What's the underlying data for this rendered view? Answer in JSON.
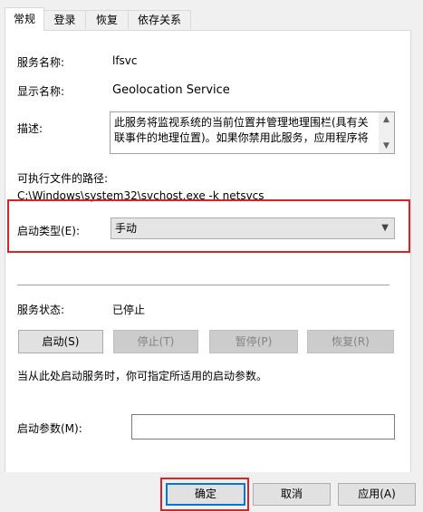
{
  "tabs": [
    {
      "label": "常规",
      "active": true
    },
    {
      "label": "登录",
      "active": false
    },
    {
      "label": "恢复",
      "active": false
    },
    {
      "label": "依存关系",
      "active": false
    }
  ],
  "general": {
    "service_name_label": "服务名称:",
    "service_name_value": "lfsvc",
    "display_name_label": "显示名称:",
    "display_name_value": "Geolocation Service",
    "description_label": "描述:",
    "description_value": "此服务将监视系统的当前位置并管理地理围栏(具有关联事件的地理位置)。如果你禁用此服务，应用程序将",
    "exe_path_label": "可执行文件的路径:",
    "exe_path_value": "C:\\Windows\\system32\\svchost.exe -k netsvcs",
    "startup_type_label": "启动类型(E):",
    "startup_type_value": "手动",
    "service_status_label": "服务状态:",
    "service_status_value": "已停止",
    "start_button": "启动(S)",
    "stop_button": "停止(T)",
    "pause_button": "暂停(P)",
    "resume_button": "恢复(R)",
    "start_params_hint": "当从此处启动服务时，你可指定所适用的启动参数。",
    "start_params_label": "启动参数(M):",
    "start_params_value": ""
  },
  "footer": {
    "ok_button": "确定",
    "cancel_button": "取消",
    "apply_button": "应用(A)"
  },
  "colors": {
    "highlight_box": "#d6242a",
    "focus_border": "#0078d7"
  }
}
